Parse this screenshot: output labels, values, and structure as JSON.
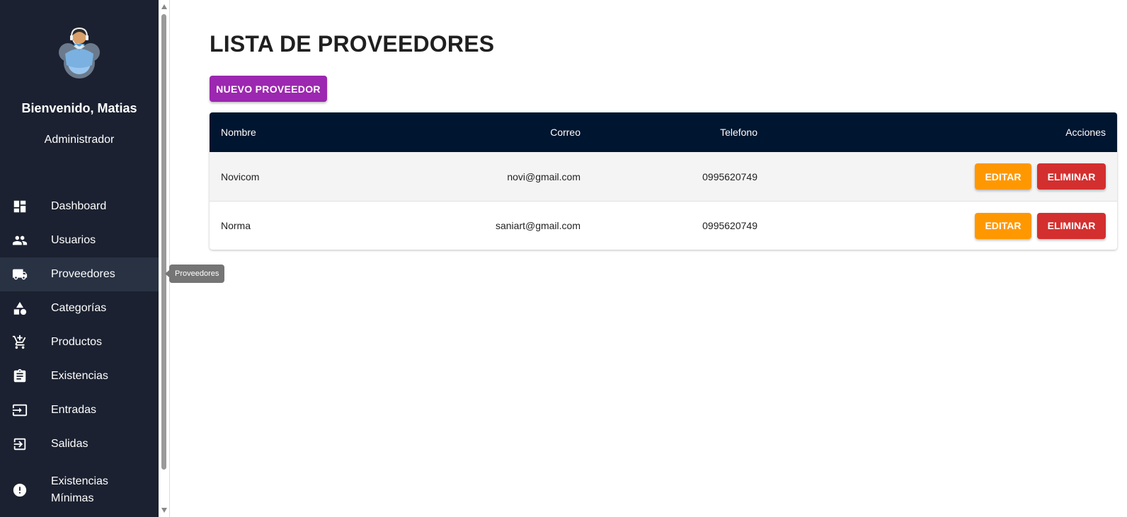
{
  "sidebar": {
    "welcome": "Bienvenido, Matias",
    "role": "Administrador",
    "avatar_icon": "support-agent-avatar",
    "items": [
      {
        "label": "Dashboard",
        "icon": "dashboard-icon"
      },
      {
        "label": "Usuarios",
        "icon": "users-icon"
      },
      {
        "label": "Proveedores",
        "icon": "truck-icon",
        "active": true
      },
      {
        "label": "Categorías",
        "icon": "category-icon"
      },
      {
        "label": "Productos",
        "icon": "cart-icon"
      },
      {
        "label": "Existencias",
        "icon": "clipboard-icon"
      },
      {
        "label": "Entradas",
        "icon": "login-icon"
      },
      {
        "label": "Salidas",
        "icon": "logout-icon"
      },
      {
        "label": "Existencias Mínimas",
        "icon": "alert-icon"
      }
    ]
  },
  "tooltip": "Proveedores",
  "main": {
    "title": "LISTA DE PROVEEDORES",
    "new_button": "NUEVO PROVEEDOR",
    "table": {
      "headers": {
        "name": "Nombre",
        "email": "Correo",
        "phone": "Telefono",
        "actions": "Acciones"
      },
      "rows": [
        {
          "name": "Novicom",
          "email": "novi@gmail.com",
          "phone": "0995620749",
          "edit": "EDITAR",
          "delete": "ELIMINAR"
        },
        {
          "name": "Norma",
          "email": "saniart@gmail.com",
          "phone": "0995620749",
          "edit": "EDITAR",
          "delete": "ELIMINAR"
        }
      ]
    }
  },
  "colors": {
    "sidebar_bg": "#1b2130",
    "active_item_bg": "#283243",
    "table_header_bg": "#00152f",
    "primary_button": "#9c27b0",
    "edit_button": "#ff9800",
    "delete_button": "#d32f2f"
  }
}
